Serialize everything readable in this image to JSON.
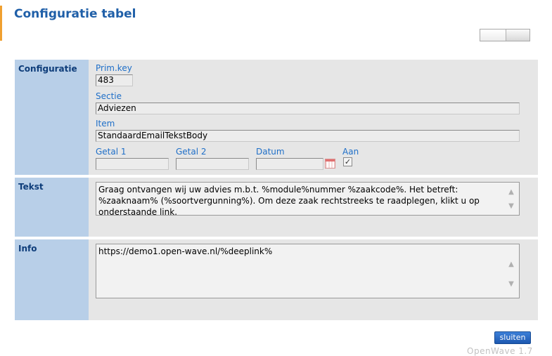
{
  "page": {
    "title": "Configuratie tabel"
  },
  "sections": {
    "config": {
      "label": "Configuratie"
    },
    "tekst": {
      "label": "Tekst"
    },
    "info": {
      "label": "Info"
    }
  },
  "fields": {
    "prim_key": {
      "label": "Prim.key",
      "value": "483"
    },
    "sectie": {
      "label": "Sectie",
      "value": "Adviezen"
    },
    "item": {
      "label": "Item",
      "value": "StandaardEmailTekstBody"
    },
    "getal1": {
      "label": "Getal 1",
      "value": ""
    },
    "getal2": {
      "label": "Getal 2",
      "value": ""
    },
    "datum": {
      "label": "Datum",
      "value": ""
    },
    "aan": {
      "label": "Aan",
      "checked": true,
      "check_glyph": "✓"
    }
  },
  "tekst": {
    "value": "Graag ontvangen wij uw advies m.b.t. %module%nummer %zaakcode%. Het betreft: %zaaknaam%  (%soortvergunning%). Om deze zaak rechtstreeks te raadplegen, klikt u op onderstaande link."
  },
  "info": {
    "value": "https://demo1.open-wave.nl/%deeplink%"
  },
  "footer": {
    "close_label": "sluiten",
    "version": "OpenWave 1.7"
  },
  "icons": {
    "scroll_up": "▲",
    "scroll_down": "▼",
    "calendar": "calendar-icon"
  },
  "colors": {
    "title": "#1f5fa8",
    "label_column": "#b8cfe8",
    "field_label": "#1f6fc8",
    "button": "#1d58b0"
  }
}
